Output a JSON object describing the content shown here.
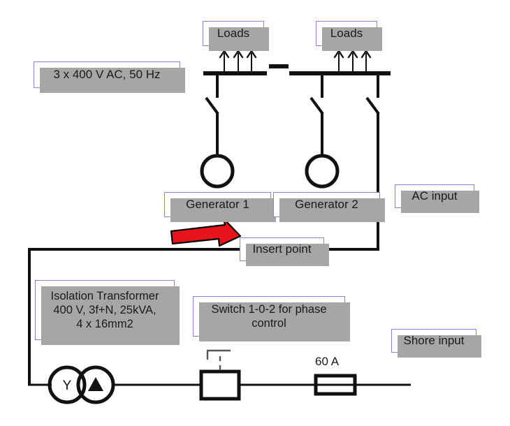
{
  "diagram": {
    "title": "Ship power single-line diagram with isolation transformer insert point",
    "colors": {
      "callout_border": "#8681de",
      "callout_shadow": "#a6a6a6",
      "line": "#111111",
      "arrow_fill": "#e8141b",
      "arrow_stroke": "#000000"
    },
    "callouts": [
      {
        "id": "loads-1",
        "label": "Loads"
      },
      {
        "id": "loads-2",
        "label": "Loads"
      },
      {
        "id": "supply-spec",
        "label": "3 x 400 V AC, 50 Hz"
      },
      {
        "id": "generator-1",
        "label": "Generator 1"
      },
      {
        "id": "generator-2",
        "label": "Generator 2"
      },
      {
        "id": "ac-input",
        "label": "AC input"
      },
      {
        "id": "insert-point",
        "label": "Insert point"
      },
      {
        "id": "isolation-transformer",
        "label": "Isolation Transformer\n400 V, 3f+N, 25kVA,\n4 x 16mm2"
      },
      {
        "id": "phase-switch",
        "label": "Switch 1-0-2 for phase control"
      },
      {
        "id": "shore-input",
        "label": "Shore input"
      }
    ],
    "isolation_transformer_lines": [
      "Isolation Transformer",
      "400 V, 3f+N, 25kVA,",
      "4 x 16mm2"
    ],
    "phase_switch_lines": [
      "Switch 1-0-2 for phase",
      "control"
    ],
    "fuse": {
      "rating": "60 A"
    },
    "transformer_symbol": {
      "primary_winding": "Y",
      "secondary_winding": "Δ"
    },
    "annotations": {
      "insert_arrow": "red-right-arrow"
    }
  }
}
